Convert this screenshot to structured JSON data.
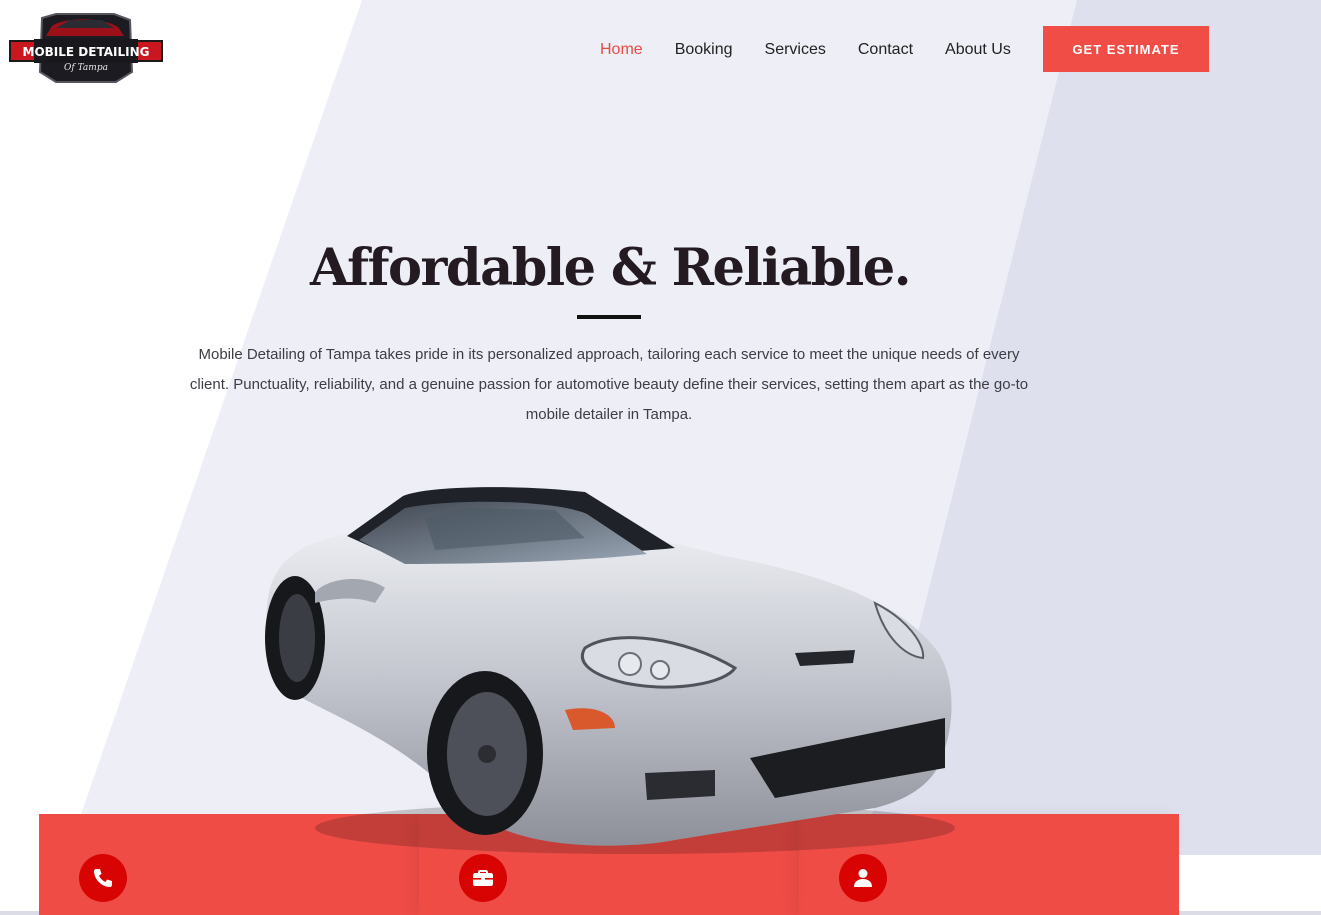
{
  "brand": {
    "logo_text_main": "MOBILE DETAILING",
    "logo_text_sub": "Of Tampa",
    "accent_color": "#f04d47"
  },
  "nav": {
    "items": [
      {
        "label": "Home",
        "active": true
      },
      {
        "label": "Booking",
        "active": false
      },
      {
        "label": "Services",
        "active": false
      },
      {
        "label": "Contact",
        "active": false
      },
      {
        "label": "About Us",
        "active": false
      }
    ],
    "cta_label": "GET ESTIMATE"
  },
  "hero": {
    "title": "Affordable & Reliable.",
    "description": "Mobile Detailing of Tampa takes pride in its personalized approach, tailoring each service to meet the unique needs of every client. Punctuality, reliability, and a genuine passion for automotive beauty define their services, setting them apart as the go-to mobile detailer in Tampa."
  },
  "features": [
    {
      "icon": "phone-icon"
    },
    {
      "icon": "briefcase-icon"
    },
    {
      "icon": "user-icon"
    }
  ]
}
